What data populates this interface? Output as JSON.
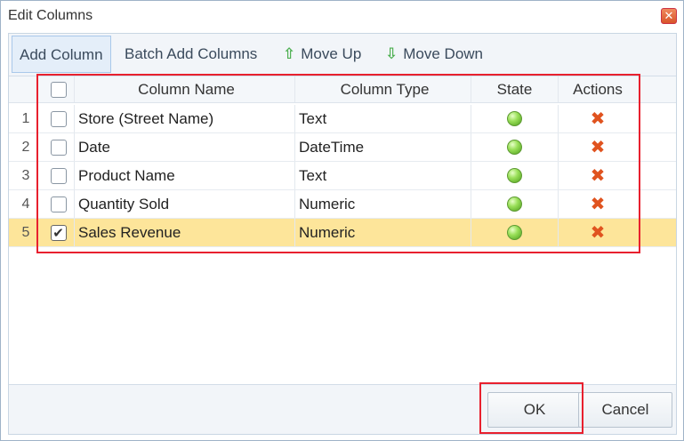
{
  "dialog": {
    "title": "Edit Columns",
    "close_icon": "close-icon"
  },
  "toolbar": {
    "add_column": "Add Column",
    "batch_add": "Batch Add Columns",
    "move_up": "Move Up",
    "move_down": "Move Down"
  },
  "grid": {
    "headers": {
      "name": "Column Name",
      "type": "Column Type",
      "state": "State",
      "actions": "Actions"
    },
    "rows": [
      {
        "num": "1",
        "name": "Store (Street Name)",
        "type": "Text",
        "checked": false
      },
      {
        "num": "2",
        "name": "Date",
        "type": "DateTime",
        "checked": false
      },
      {
        "num": "3",
        "name": "Product Name",
        "type": "Text",
        "checked": false
      },
      {
        "num": "4",
        "name": "Quantity Sold",
        "type": "Numeric",
        "checked": false
      },
      {
        "num": "5",
        "name": "Sales Revenue",
        "type": "Numeric",
        "checked": true
      }
    ]
  },
  "footer": {
    "ok": "OK",
    "cancel": "Cancel"
  },
  "colors": {
    "selected_row": "#fde59a",
    "highlight_border": "#e8202e",
    "state_ok": "#7ec845",
    "delete": "#e0531f"
  }
}
